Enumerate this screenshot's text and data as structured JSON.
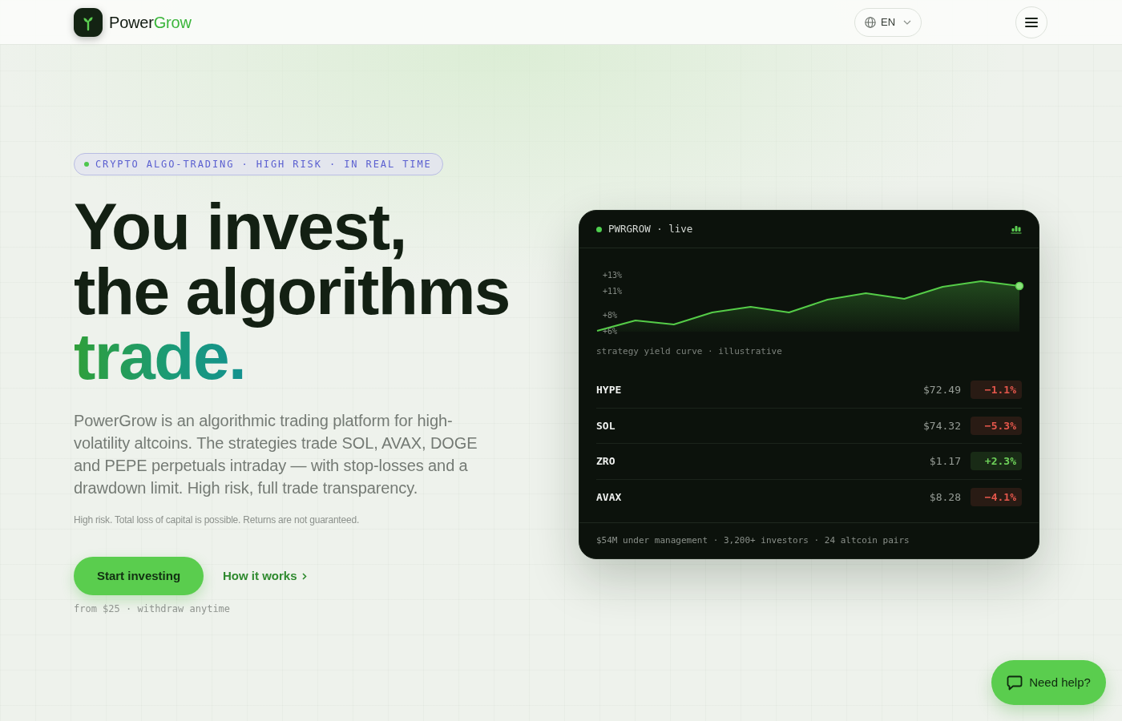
{
  "header": {
    "brand": {
      "name": "Power",
      "accent": "Grow"
    },
    "language": "EN"
  },
  "hero": {
    "tagline": "CRYPTO ALGO-TRADING · HIGH RISK · IN REAL TIME",
    "headline": [
      {
        "text": "You invest,",
        "highlighted": false
      },
      {
        "text": "the algorithms",
        "highlighted": false
      },
      {
        "text": "trade.",
        "highlighted": true
      }
    ],
    "description": "PowerGrow is an algorithmic trading platform for high-volatility altcoins. The strategies trade SOL, AVAX, DOGE and PEPE perpetuals intraday — with stop-losses and a drawdown limit. High risk, full trade transparency.",
    "disclaimer": "High risk. Total loss of capital is possible. Returns are not guaranteed.",
    "primary_button": "Start investing",
    "secondary_link": "How it works",
    "note": "from $25 · withdraw anytime"
  },
  "ticker_card": {
    "title": "PWRGROW · live",
    "chart_data": {
      "type": "area",
      "categories": [
        null,
        null,
        null,
        null,
        null,
        null,
        null,
        null,
        null,
        null,
        null,
        null
      ],
      "series": [
        {
          "color": "#55cc48",
          "values": [
            6.1,
            7.4,
            6.9,
            8.4,
            9.1,
            8.4,
            10.0,
            10.8,
            10.1,
            11.6,
            12.3,
            11.7
          ]
        }
      ],
      "ylim": [
        6,
        13
      ],
      "yticks": [
        {
          "value": 13,
          "label": "+13%"
        },
        {
          "value": 11,
          "label": "+11%"
        },
        {
          "value": 8,
          "label": "+8%"
        },
        {
          "value": 6,
          "label": "+6%"
        }
      ]
    },
    "chart_caption": "strategy yield curve · illustrative",
    "assets": [
      {
        "symbol": "HYPE",
        "price": "$72.49",
        "change": "−1.1%",
        "color": "#e5574c"
      },
      {
        "symbol": "SOL",
        "price": "$74.32",
        "change": "−5.3%",
        "color": "#e5574c"
      },
      {
        "symbol": "ZRO",
        "price": "$1.17",
        "change": "+2.3%",
        "color": "#6fd35a"
      },
      {
        "symbol": "AVAX",
        "price": "$8.28",
        "change": "−4.1%",
        "color": "#e5574c"
      }
    ],
    "footer": "$54M under management · 3,200+ investors · 24 altcoin pairs"
  },
  "help_button": "Need help?"
}
